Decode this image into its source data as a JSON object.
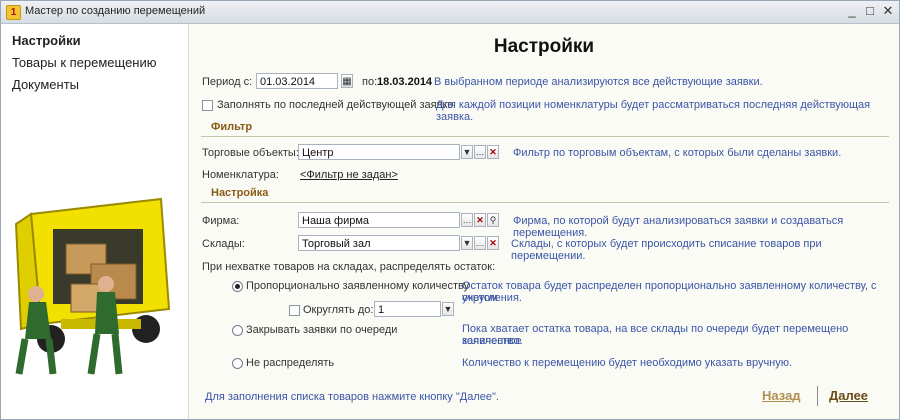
{
  "window": {
    "title": "Мастер по созданию перемещений",
    "minimize": "_",
    "maximize": "□",
    "close": "✕"
  },
  "sidebar": {
    "items": [
      {
        "label": "Настройки"
      },
      {
        "label": "Товары к перемещению"
      },
      {
        "label": "Документы"
      }
    ]
  },
  "main": {
    "heading": "Настройки",
    "period": {
      "label": "Период с:",
      "from": "01.03.2014",
      "to_label": "по:",
      "to": "18.03.2014",
      "hint": "В выбранном периоде анализируются все действующие заявки."
    },
    "fill_last": {
      "label": "Заполнять по последней действующей заявке",
      "hint": "Для каждой позиции номенклатуры будет рассматриваться последняя действующая заявка."
    },
    "filter_section": "Фильтр",
    "trade_objects": {
      "label": "Торговые объекты:",
      "value": "Центр",
      "hint": "Фильтр по торговым объектам, с которых были сделаны заявки."
    },
    "nomenclature": {
      "label": "Номенклатура:",
      "link": "<Фильтр не задан>"
    },
    "settings_section": "Настройка",
    "firm": {
      "label": "Фирма:",
      "value": "Наша фирма",
      "hint": "Фирма, по которой будут анализироваться заявки и создаваться перемещения."
    },
    "warehouses": {
      "label": "Склады:",
      "value": "Торговый зал",
      "hint": "Склады, с которых будет происходить списание товаров при перемещении."
    },
    "distribute_label": "При нехватке товаров на складах, распределять остаток:",
    "options": {
      "proportional": {
        "label": "Пропорционально заявленному количеству",
        "hint_line1": "Остаток товара будет распределен пропорционально заявленному количеству, с учетом",
        "hint_line2": "округления."
      },
      "round": {
        "label": "Округлять до:",
        "value": "1"
      },
      "queue": {
        "label": "Закрывать заявки по очереди",
        "hint_line1": "Пока хватает остатка товара, на все склады по очереди будет перемещено заявленное",
        "hint_line2": "количество."
      },
      "none": {
        "label": "Не распределять",
        "hint": "Количество к перемещению будет необходимо указать вручную."
      }
    },
    "footer_hint": "Для заполнения списка товаров нажмите кнопку \"Далее\".",
    "back_button": "Назад",
    "next_button": "Далее"
  },
  "icons": {
    "calendar": "calendar-icon",
    "dropdown": "chevron-down-icon",
    "select": "ellipsis-icon",
    "clear": "clear-icon",
    "open": "search-icon"
  },
  "colors": {
    "hint": "#3a55a6",
    "section": "#8a5a14",
    "back": "#b09050",
    "next": "#6b4b1a"
  }
}
